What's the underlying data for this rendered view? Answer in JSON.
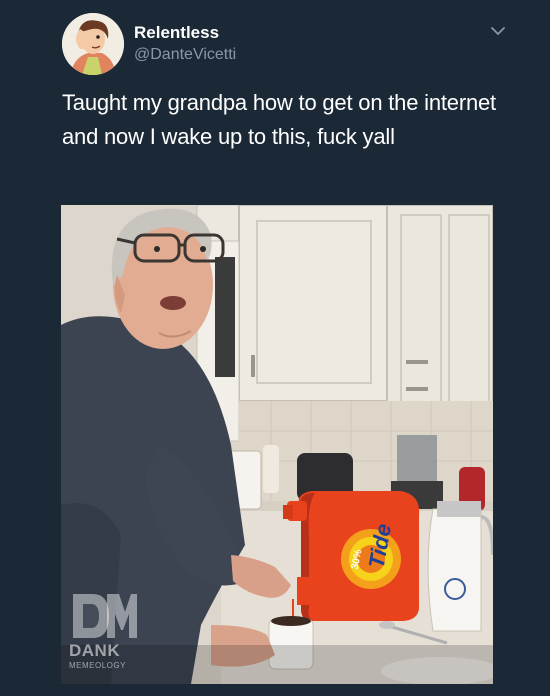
{
  "tweet": {
    "display_name": "Relentless",
    "handle": "@DanteVicetti",
    "text": "Taught my grandpa how to get on the internet and now I wake up to this, fuck yall",
    "menu_icon": "chevron-down-icon"
  },
  "photo": {
    "product_label": "Tide",
    "product_badge": "30%",
    "watermark_title": "DANK",
    "watermark_subtitle": "MEMEOLOGY"
  },
  "colors": {
    "background": "#1b2836",
    "secondary_text": "#8899a6",
    "tide_orange": "#e8431c"
  }
}
